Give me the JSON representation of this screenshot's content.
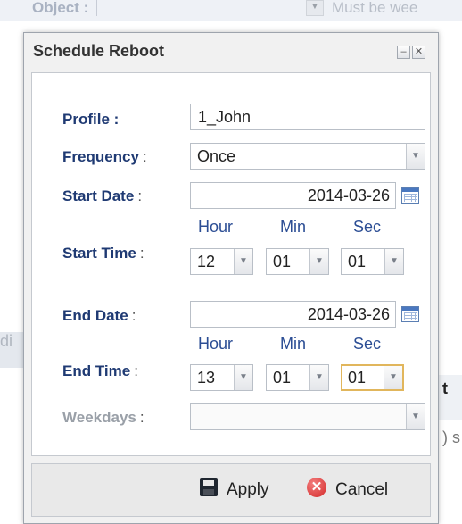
{
  "background": {
    "object_label": "Object :",
    "hint_text": "Must be wee",
    "left_fragment": "di",
    "right_fragment_t": "t",
    "right_fragment_s": ") s"
  },
  "dialog": {
    "title": "Schedule Reboot",
    "minimize_label": "–",
    "close_label": "✕",
    "form": {
      "profile": {
        "label": "Profile :",
        "value": "1_John"
      },
      "frequency": {
        "label": "Frequency",
        "colon": ":",
        "value": "Once"
      },
      "start_date": {
        "label": "Start Date",
        "colon": ":",
        "value": "2014-03-26"
      },
      "start_time": {
        "label": "Start Time",
        "colon": ":",
        "hour_header": "Hour",
        "min_header": "Min",
        "sec_header": "Sec",
        "hour": "12",
        "min": "01",
        "sec": "01"
      },
      "end_date": {
        "label": "End Date",
        "colon": ":",
        "value": "2014-03-26"
      },
      "end_time": {
        "label": "End Time",
        "colon": ":",
        "hour_header": "Hour",
        "min_header": "Min",
        "sec_header": "Sec",
        "hour": "13",
        "min": "01",
        "sec": "01"
      },
      "weekdays": {
        "label": "Weekdays",
        "colon": ":",
        "value": ""
      }
    },
    "footer": {
      "apply_label": "Apply",
      "cancel_label": "Cancel"
    }
  },
  "icons": {
    "select_arrow": "chevron-down-icon",
    "calendar": "calendar-icon",
    "apply": "save-icon",
    "cancel": "cancel-icon"
  },
  "colors": {
    "label_blue": "#1f3a73",
    "focus_border": "#e1b65c",
    "cancel_red": "#d32a2a"
  }
}
